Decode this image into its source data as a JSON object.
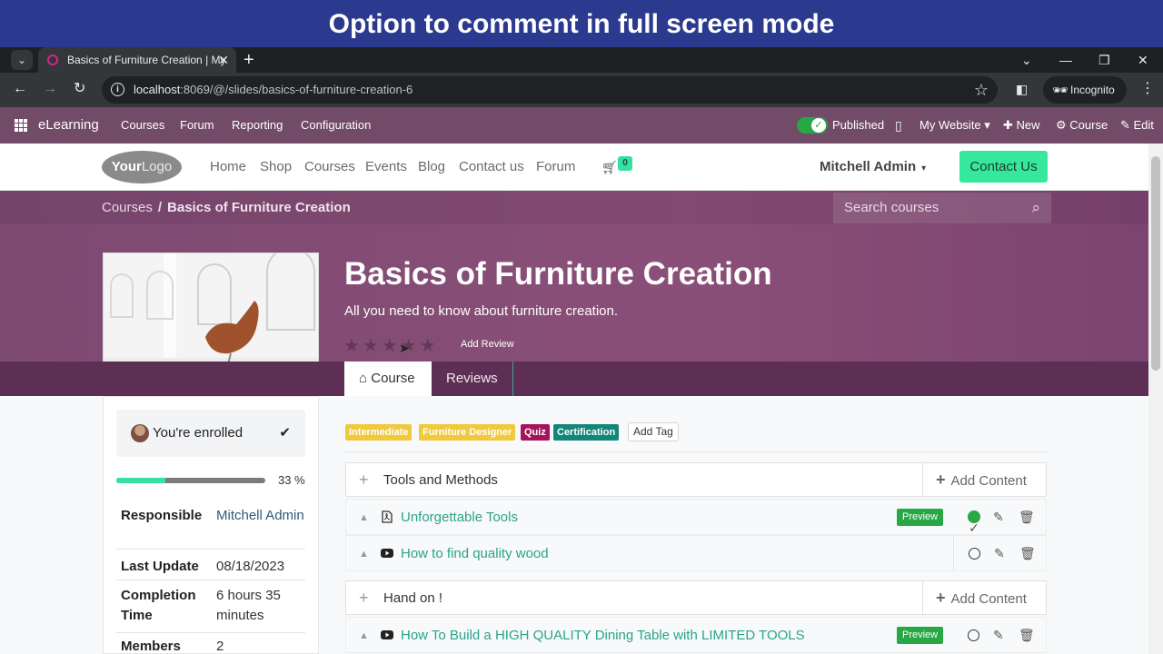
{
  "banner": {
    "text": "Option to comment in full screen mode"
  },
  "browser": {
    "tab_title": "Basics of Furniture Creation | My",
    "url_host": "localhost",
    "url_rest": ":8069/@/slides/basics-of-furniture-creation-6",
    "incognito_label": "Incognito"
  },
  "odoo_bar": {
    "app_name": "eLearning",
    "menu": [
      "Courses",
      "Forum",
      "Reporting",
      "Configuration"
    ],
    "published_label": "Published",
    "website_label": "My Website",
    "new_label": "New",
    "course_label": "Course",
    "edit_label": "Edit"
  },
  "site_header": {
    "logo_bold": "Your",
    "logo_light": "Logo",
    "menu": [
      "Home",
      "Shop",
      "Courses",
      "Events",
      "Blog",
      "Contact us",
      "Forum"
    ],
    "cart_count": "0",
    "user_name": "Mitchell Admin",
    "contact_button": "Contact Us"
  },
  "breadcrumb": {
    "parent": "Courses",
    "current": "Basics of Furniture Creation"
  },
  "search": {
    "placeholder": "Search courses"
  },
  "course": {
    "title": "Basics of Furniture Creation",
    "subtitle": "All you need to know about furniture creation.",
    "rating_stars": 0,
    "add_review": "Add Review",
    "tabs": {
      "course": "Course",
      "reviews": "Reviews"
    }
  },
  "sidebar": {
    "enrolled_label": "You're enrolled",
    "progress_percent": 33,
    "progress_label": "33 %",
    "info": [
      {
        "key": "Responsible",
        "value": "Mitchell Admin"
      },
      {
        "key": "Last Update",
        "value": "08/18/2023"
      },
      {
        "key": "Completion Time",
        "value": "6 hours 35 minutes"
      },
      {
        "key": "Members",
        "value": "2"
      }
    ]
  },
  "tags": {
    "items": [
      {
        "label": "Intermediate",
        "color": "#f0c93c"
      },
      {
        "label": "Furniture Designer",
        "color": "#f0c93c"
      },
      {
        "label": "Quiz",
        "color": "#a5145a"
      },
      {
        "label": "Certification",
        "color": "#13867a"
      }
    ],
    "add_tag": "Add Tag"
  },
  "content": {
    "add_content_label": "Add Content",
    "preview_label": "Preview",
    "sections": [
      {
        "title": "Tools and Methods",
        "lessons": [
          {
            "name": "Unforgettable Tools",
            "type": "pdf-icon",
            "preview": true,
            "completed": true
          },
          {
            "name": "How to find quality wood",
            "type": "youtube-icon",
            "preview": false,
            "completed": false
          }
        ]
      },
      {
        "title": "Hand on !",
        "lessons": [
          {
            "name": "How To Build a HIGH QUALITY Dining Table with LIMITED TOOLS",
            "type": "youtube-icon",
            "preview": true,
            "completed": false
          }
        ]
      }
    ]
  },
  "colors": {
    "odoo_purple": "#714b67",
    "hero_purple": "#8a4f78",
    "accent_green": "#35e0a0",
    "link_teal": "#2aa38a",
    "banner_blue": "#2b3a8f"
  }
}
